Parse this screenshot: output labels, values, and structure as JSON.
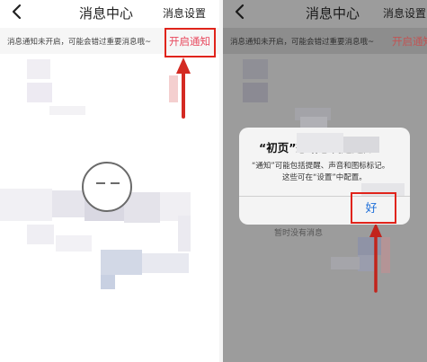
{
  "left": {
    "nav": {
      "back_icon": "chevron-left-icon",
      "title": "消息中心",
      "action": "消息设置"
    },
    "notice": {
      "text": "消息通知未开启，可能会错过重要消息哦~",
      "link": "开启通知"
    }
  },
  "right": {
    "nav": {
      "back_icon": "chevron-left-icon",
      "title": "消息中心",
      "action": "消息设置"
    },
    "notice": {
      "text": "消息通知未开启，可能会错过重要消息哦~",
      "link": "开启通知"
    },
    "dialog": {
      "title": "“初页”想给您发送通知",
      "line1": "“通知”可能包括提醒、声音和图标标记。",
      "line2": "这些可在“设置”中配置。",
      "button": "好"
    },
    "empty_text": "暂时没有消息"
  },
  "colors": {
    "highlight": "#e0241b",
    "accent_link": "#e84a5f",
    "ios_blue": "#1e6fd9"
  },
  "icons": {
    "arrow_up": "arrow-up-icon",
    "empty_state": "empty-face-icon"
  }
}
